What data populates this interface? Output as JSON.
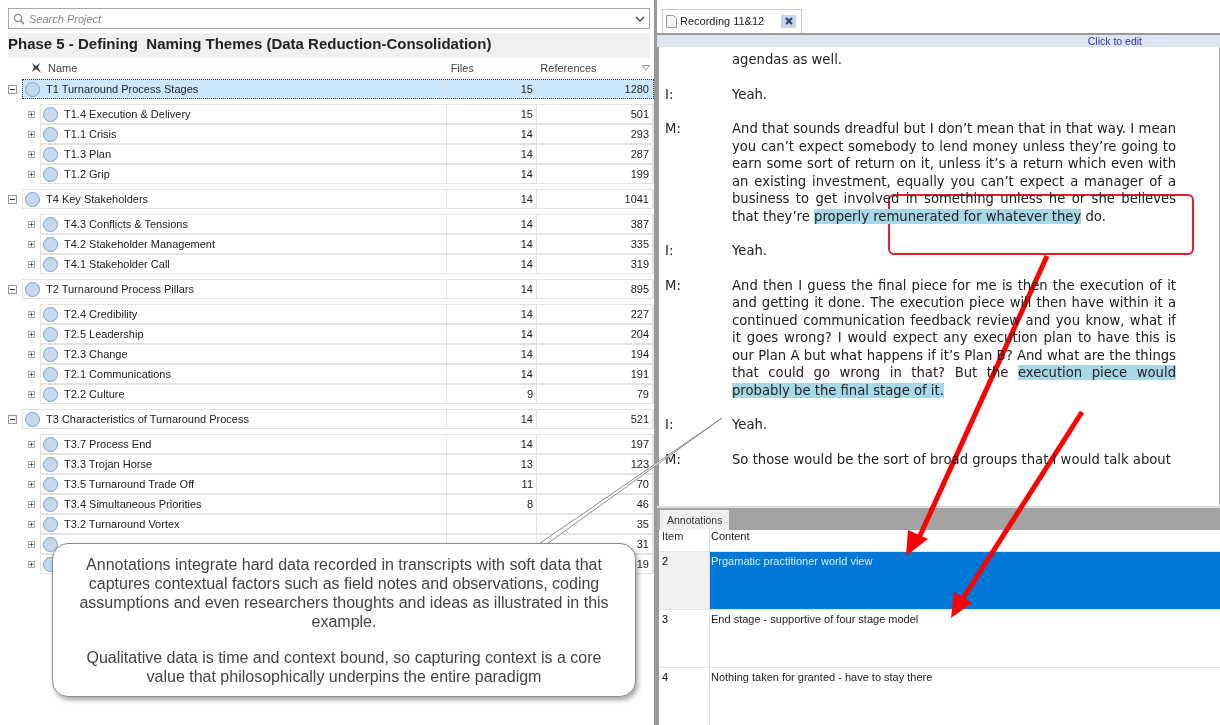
{
  "search": {
    "placeholder": "Search Project"
  },
  "title": "Phase 5 - Defining  Naming Themes (Data Reduction-Consolidation)",
  "columns": [
    "Name",
    "Files",
    "References"
  ],
  "themes": [
    {
      "name": "T1 Turnaround Process Stages",
      "files": "15",
      "references": "1280",
      "selected": true,
      "expanded": true,
      "children": [
        {
          "name": "T1.4 Execution & Delivery",
          "files": "15",
          "references": "501",
          "selected": false,
          "expanded": false
        },
        {
          "name": "T1.1 Crisis",
          "files": "14",
          "references": "293",
          "selected": false,
          "expanded": false
        },
        {
          "name": "T1.3 Plan",
          "files": "14",
          "references": "287",
          "selected": false,
          "expanded": false
        },
        {
          "name": "T1.2 Grip",
          "files": "14",
          "references": "199",
          "selected": false,
          "expanded": false
        }
      ]
    },
    {
      "name": "T4 Key Stakeholders",
      "files": "14",
      "references": "1041",
      "selected": false,
      "expanded": true,
      "children": [
        {
          "name": "T4.3 Conflicts & Tensions",
          "files": "14",
          "references": "387",
          "selected": false,
          "expanded": false
        },
        {
          "name": "T4.2 Stakeholder Management",
          "files": "14",
          "references": "335",
          "selected": false,
          "expanded": false
        },
        {
          "name": "T4.1 Stakeholder Call",
          "files": "14",
          "references": "319",
          "selected": false,
          "expanded": false
        }
      ]
    },
    {
      "name": "T2 Turnaround Process Pillars",
      "files": "14",
      "references": "895",
      "selected": false,
      "expanded": true,
      "children": [
        {
          "name": "T2.4 Credibility",
          "files": "14",
          "references": "227",
          "selected": false,
          "expanded": false
        },
        {
          "name": "T2.5 Leadership",
          "files": "14",
          "references": "204",
          "selected": false,
          "expanded": false
        },
        {
          "name": "T2.3 Change",
          "files": "14",
          "references": "194",
          "selected": false,
          "expanded": false
        },
        {
          "name": "T2.1 Communications",
          "files": "14",
          "references": "191",
          "selected": false,
          "expanded": false
        },
        {
          "name": "T2.2 Culture",
          "files": "9",
          "references": "79",
          "selected": false,
          "expanded": false
        }
      ]
    },
    {
      "name": "T3 Characteristics of Turnaround Process",
      "files": "14",
      "references": "521",
      "selected": false,
      "expanded": true,
      "children": [
        {
          "name": "T3.7 Process End",
          "files": "14",
          "references": "197",
          "selected": false,
          "expanded": false
        },
        {
          "name": "T3.3 Trojan Horse",
          "files": "13",
          "references": "123",
          "selected": false,
          "expanded": false
        },
        {
          "name": "T3.5 Turnaround Trade Off",
          "files": "11",
          "references": "70",
          "selected": false,
          "expanded": false
        },
        {
          "name": "T3.4 Simultaneous Priorities",
          "files": "8",
          "references": "46",
          "selected": false,
          "expanded": false
        },
        {
          "name": "T3.2 Turnaround Vortex",
          "references": "35",
          "selected": false,
          "expanded": false
        },
        {
          "references": "31",
          "selected": false,
          "expanded": false
        },
        {
          "references": "19",
          "selected": false,
          "expanded": false
        }
      ]
    }
  ],
  "document_tab": {
    "label": "Recording 11&12"
  },
  "edit_hint": "Click to edit",
  "transcript": [
    {
      "segments": [
        {
          "text": "agendas as well.",
          "highlighted": false
        }
      ]
    },
    {
      "speaker": "I:",
      "segments": [
        {
          "text": "Yeah.",
          "highlighted": false
        }
      ]
    },
    {
      "speaker": "M:",
      "segments": [
        {
          "text": "And that sounds dreadful but I don’t mean that in that way. I mean you can’t expect somebody to lend money unless they’re going to earn some sort of return on it, unless it’s a return which even with an existing investment, equally you can’t expect a manager of a business to get involved in something unless he or she believes that they’re ",
          "highlighted": false
        },
        {
          "text": "properly remunerated for whatever they",
          "highlighted": true
        },
        {
          "text": " do.",
          "highlighted": false
        }
      ]
    },
    {
      "speaker": "I:",
      "segments": [
        {
          "text": "Yeah.",
          "highlighted": false
        }
      ]
    },
    {
      "speaker": "M:",
      "segments": [
        {
          "text": "And then I guess the final piece for me is then the execution of it and getting it done. The execution piece will then have within it a continued communication feedback review and you know, what if it goes wrong? I would expect any execution plan to have this is our Plan A but what happens if it’s Plan B? And what are the things that could go wrong in that? But the ",
          "highlighted": false
        },
        {
          "text": "execution piece would probably be the final stage of it.",
          "highlighted": true
        }
      ]
    },
    {
      "speaker": "I:",
      "segments": [
        {
          "text": "Yeah.",
          "highlighted": false
        }
      ]
    },
    {
      "speaker": "M:",
      "segments": [
        {
          "text": "So those would be the sort of broad groups that I would talk about",
          "highlighted": false
        }
      ]
    }
  ],
  "annotations": {
    "tab": "Annotations",
    "columns": [
      "Item",
      "Content"
    ],
    "rows": [
      {
        "item": "2",
        "content": "Prgamatic practitioner world view",
        "selected": true
      },
      {
        "item": "3",
        "content": "End stage - supportive of four stage model",
        "selected": false
      },
      {
        "item": "4",
        "content": "Nothing taken for granted - have to stay there",
        "selected": false
      }
    ]
  },
  "callout": {
    "paragraphs": [
      "Annotations integrate hard data recorded in transcripts with soft data that captures contextual factors such as field notes and observations, coding assumptions and even researchers thoughts and ideas as illustrated in this example.",
      "Qualitative data is time and context bound, so capturing context is a core value that philosophically underpins the entire paradigm"
    ]
  }
}
